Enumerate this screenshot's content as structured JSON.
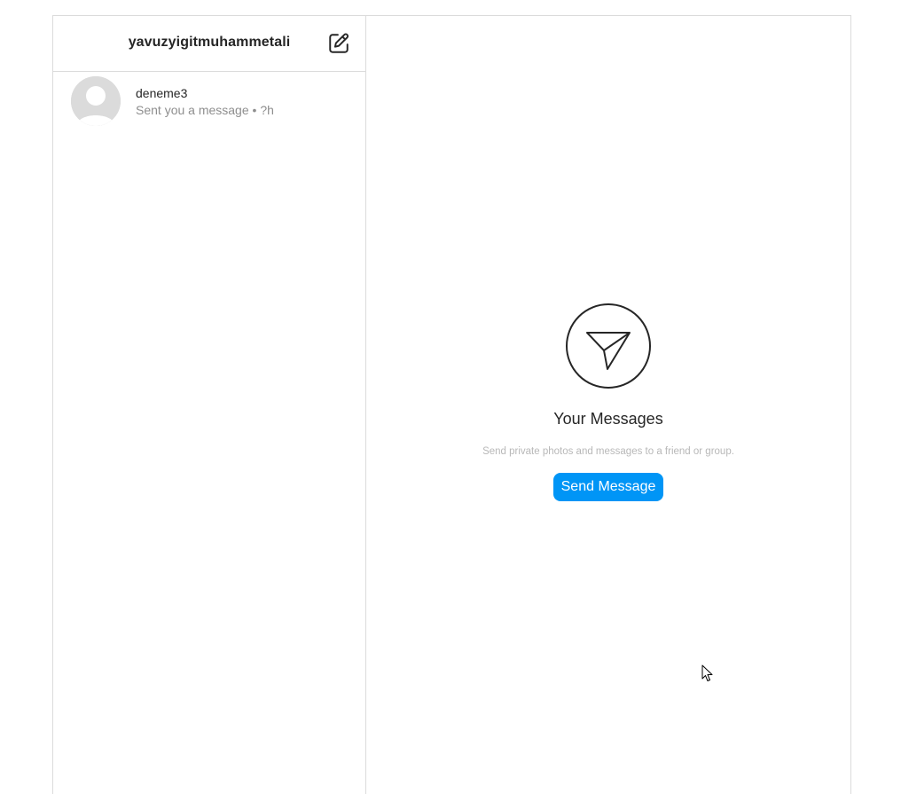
{
  "header": {
    "username": "yavuzyigitmuhammetali",
    "compose_icon": "edit-icon"
  },
  "conversations": [
    {
      "name": "deneme3",
      "preview": "Sent you a message • ?h",
      "avatar_icon": "default-avatar-icon"
    }
  ],
  "empty_state": {
    "icon": "paper-plane-icon",
    "title": "Your Messages",
    "subtitle": "Send private photos and messages to a friend or group.",
    "button_label": "Send Message"
  },
  "colors": {
    "accent": "#0095f6",
    "border": "#dbdbdb",
    "text": "#262626",
    "muted": "#8e8e8e"
  }
}
